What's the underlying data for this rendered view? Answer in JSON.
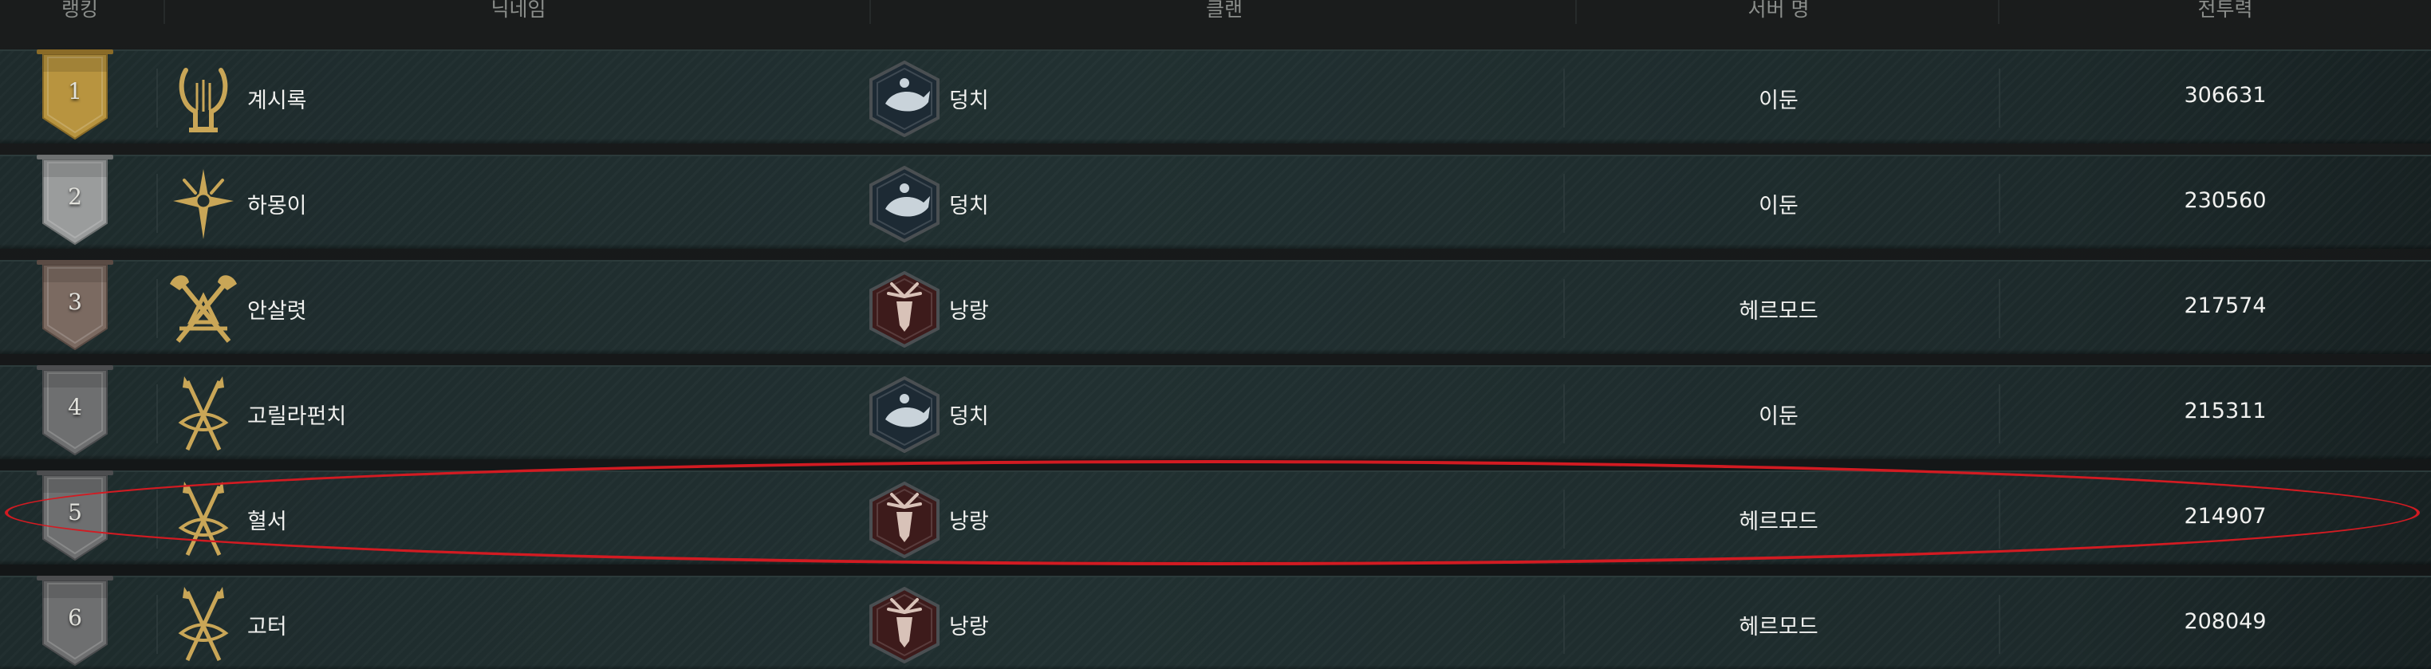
{
  "header": {
    "rank": "랭킹",
    "nickname": "닉네임",
    "clan": "클랜",
    "server": "서버 명",
    "power": "전투력"
  },
  "colors": {
    "gold_banner": "#b8943f",
    "silver_banner": "#9a9c9c",
    "bronze_banner": "#7b6a61",
    "gray_banner": "#6e6f70",
    "class_icon_gold": "#c9a657",
    "clan_blue": "#1d2a34",
    "clan_red": "#3d1b1b",
    "highlight": "#d21b22"
  },
  "rows": [
    {
      "rank": "1",
      "banner": "gold",
      "class_icon": "lyre-icon",
      "name": "계시록",
      "clan_icon": "whale-emblem-icon",
      "clan": "덩치",
      "server": "이둔",
      "power": "306631"
    },
    {
      "rank": "2",
      "banner": "silver",
      "class_icon": "star-emblem-icon",
      "name": "하몽이",
      "clan_icon": "whale-emblem-icon",
      "clan": "덩치",
      "server": "이둔",
      "power": "230560"
    },
    {
      "rank": "3",
      "banner": "bronze",
      "class_icon": "crossed-axes-icon",
      "name": "안살렷",
      "clan_icon": "stag-emblem-icon",
      "clan": "낭랑",
      "server": "헤르모드",
      "power": "217574"
    },
    {
      "rank": "4",
      "banner": "gray",
      "class_icon": "crossed-spears-icon",
      "name": "고릴라펀치",
      "clan_icon": "whale-emblem-icon",
      "clan": "덩치",
      "server": "이둔",
      "power": "215311"
    },
    {
      "rank": "5",
      "banner": "gray",
      "class_icon": "crossed-spears-icon",
      "name": "혈서",
      "clan_icon": "stag-emblem-icon",
      "clan": "낭랑",
      "server": "헤르모드",
      "power": "214907"
    },
    {
      "rank": "6",
      "banner": "gray",
      "class_icon": "crossed-spears-icon",
      "name": "고터",
      "clan_icon": "stag-emblem-icon",
      "clan": "낭랑",
      "server": "헤르모드",
      "power": "208049"
    }
  ]
}
